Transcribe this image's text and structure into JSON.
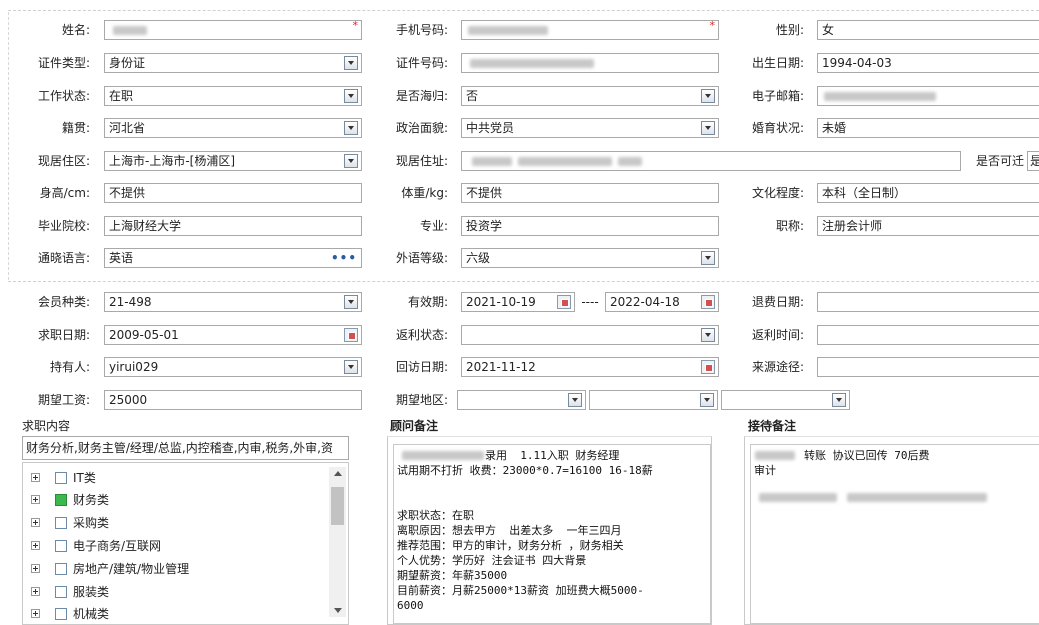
{
  "form": {
    "name": {
      "label": "姓名:"
    },
    "mobile": {
      "label": "手机号码:"
    },
    "gender": {
      "label": "性别:",
      "value": "女"
    },
    "id_type": {
      "label": "证件类型:",
      "value": "身份证"
    },
    "id_number": {
      "label": "证件号码:"
    },
    "birth_date": {
      "label": "出生日期:",
      "value": "1994-04-03"
    },
    "work_status": {
      "label": "工作状态:",
      "value": "在职"
    },
    "returnee": {
      "label": "是否海归:",
      "value": "否"
    },
    "email": {
      "label": "电子邮箱:"
    },
    "native_place": {
      "label": "籍贯:",
      "value": "河北省"
    },
    "political": {
      "label": "政治面貌:",
      "value": "中共党员"
    },
    "marital": {
      "label": "婚育状况:",
      "value": "未婚"
    },
    "residence_area": {
      "label": "现居住区:",
      "value": "上海市-上海市-[杨浦区]"
    },
    "residence_address": {
      "label": "现居住址:"
    },
    "relocate": {
      "label": "是否可迁",
      "value": "是"
    },
    "height": {
      "label": "身高/cm:",
      "value": "不提供"
    },
    "weight": {
      "label": "体重/kg:",
      "value": "不提供"
    },
    "education": {
      "label": "文化程度:",
      "value": "本科（全日制）"
    },
    "school": {
      "label": "毕业院校:",
      "value": "上海财经大学"
    },
    "major": {
      "label": "专业:",
      "value": "投资学"
    },
    "title": {
      "label": "职称:",
      "value": "注册会计师"
    },
    "language": {
      "label": "通晓语言:",
      "value": "英语"
    },
    "language_level": {
      "label": "外语等级:",
      "value": "六级"
    },
    "member_type": {
      "label": "会员种类:",
      "value": "21-498"
    },
    "validity": {
      "label": "有效期:",
      "from": "2021-10-19",
      "sep": "----",
      "to": "2022-04-18"
    },
    "refund_date": {
      "label": "退费日期:",
      "value": ""
    },
    "job_seek_date": {
      "label": "求职日期:",
      "value": "2009-05-01"
    },
    "rebate_status": {
      "label": "返利状态:",
      "value": ""
    },
    "rebate_time": {
      "label": "返利时间:",
      "value": ""
    },
    "holder": {
      "label": "持有人:",
      "value": "yirui029"
    },
    "revisit_date": {
      "label": "回访日期:",
      "value": "2021-11-12"
    },
    "source": {
      "label": "来源途径:",
      "value": ""
    },
    "expected_salary": {
      "label": "期望工资:",
      "value": "25000"
    },
    "expected_region": {
      "label": "期望地区:"
    }
  },
  "job_intent": {
    "title": "求职内容",
    "summary": "财务分析,财务主管/经理/总监,内控稽查,内审,税务,外审,资",
    "tree": [
      {
        "label": "IT类",
        "checked": false
      },
      {
        "label": "财务类",
        "checked": true
      },
      {
        "label": "采购类",
        "checked": false
      },
      {
        "label": "电子商务/互联网",
        "checked": false
      },
      {
        "label": "房地产/建筑/物业管理",
        "checked": false
      },
      {
        "label": "服装类",
        "checked": false
      },
      {
        "label": "机械类",
        "checked": false
      }
    ]
  },
  "consultant_notes": {
    "title": "顾问备注",
    "text": "录用  1.11入职 财务经理\n试用期不打折 收费：23000*0.7=16100 16-18薪\n\n\n求职状态：在职\n离职原因：想去甲方  出差太多  一年三四月\n推荐范围：甲方的审计，财务分析 ，财务相关\n个人优势：学历好 注会证书 四大背景\n期望薪资：年薪35000\n目前薪资：月薪25000*13薪资 加班费大概5000-\n6000"
  },
  "reception_notes": {
    "title": "接待备注",
    "text": "转账 协议已回传 70后费\n审计"
  },
  "colors": {
    "required_mark": "#e02020",
    "checked": "#3cb94c",
    "border": "#a9a9a9"
  }
}
